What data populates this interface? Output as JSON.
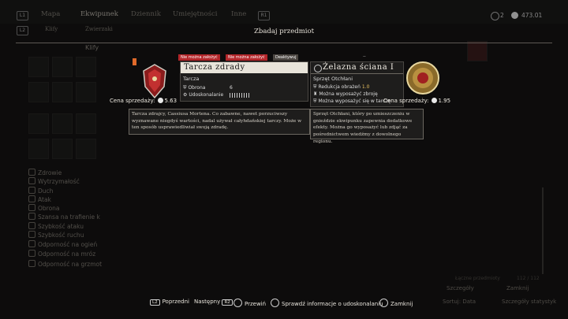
{
  "top_nav": {
    "left_button": "L1",
    "right_button": "R1",
    "tabs": [
      "Mapa",
      "Ekwipunek",
      "Dziennik",
      "Umiejętności",
      "Inne"
    ],
    "active_tab": "Ekwipunek",
    "sub_button": "L2",
    "sub_tabs": [
      "Klify",
      "Zwierzaki"
    ],
    "currency_1": "2",
    "currency_2": "473.01"
  },
  "background": {
    "category_title": "Klify",
    "stats": [
      "Zdrowie",
      "Wytrzymałość",
      "Duch",
      "Atak",
      "Obrona",
      "Szansa na trafienie k",
      "Szybkość ataku",
      "Szybkość ruchu",
      "Odporność na ogień",
      "Odporność na mróz",
      "Odporność na grzmot"
    ],
    "right_count": "112 / 112",
    "right_label": "Łączne przedmioty"
  },
  "modal": {
    "title": "Zbadaj przedmiot",
    "left_item": {
      "badges": [
        "Nie można założyć",
        "Nie można założyć",
        "Deaktywuj"
      ],
      "name": "Tarcza zdrady",
      "type": "Tarcza",
      "stat_label": "Obrona",
      "stat_value": "6",
      "upgrade_label": "Udoskonalanie",
      "price_label": "Cena sprzedaży:",
      "price_value": "5.63",
      "description": "Tarcza zdrajcy, Cassiusa Mortena. Co zabawne, nawet porzuciwszy wyznawane niegdyś wartości, nadal używał całyhdańskiej tarczy. Może w ten sposób usprawiedliwiał swoją zdradę."
    },
    "right_item": {
      "name": "Żelazna ściana I",
      "type": "Sprzęt Otchłani",
      "row1_label": "Redukcja obrażeń",
      "row1_value": "1.0",
      "row2": "Można wyposażyć zbroję",
      "row3": "Można wyposażyć się w tarczę",
      "price_label": "Cena sprzedaży:",
      "price_value": "1.95",
      "description": "Sprzęt Otchłani, który po umieszczeniu w gnieździe ekwipunku zapewnia dodatkowe efekty. Można go wyposażyć lub zdjąć za pośrednictwem wiedźmy z dowolnego regionu."
    }
  },
  "bottom_hints": {
    "prev_key": "L2",
    "prev_label": "Poprzedni",
    "next_label": "Następny",
    "next_key": "R2",
    "scroll_label": "Przewiń",
    "info_label": "Sprawdź informacje o udoskonalaniu",
    "close_label": "Zamknij",
    "bg_details": "Szczegóły",
    "bg_sort": "Sortuj: Data",
    "bg_stats": "Szczegóły statystyk",
    "bg_close": "Zamknij"
  },
  "colors": {
    "background": "#141313",
    "card": "#1e1d1c",
    "badge_red": "#b3262a",
    "badge_dark": "#4a4540",
    "desc_bg": "#d2ccc2",
    "text_light": "#f0ece3"
  }
}
